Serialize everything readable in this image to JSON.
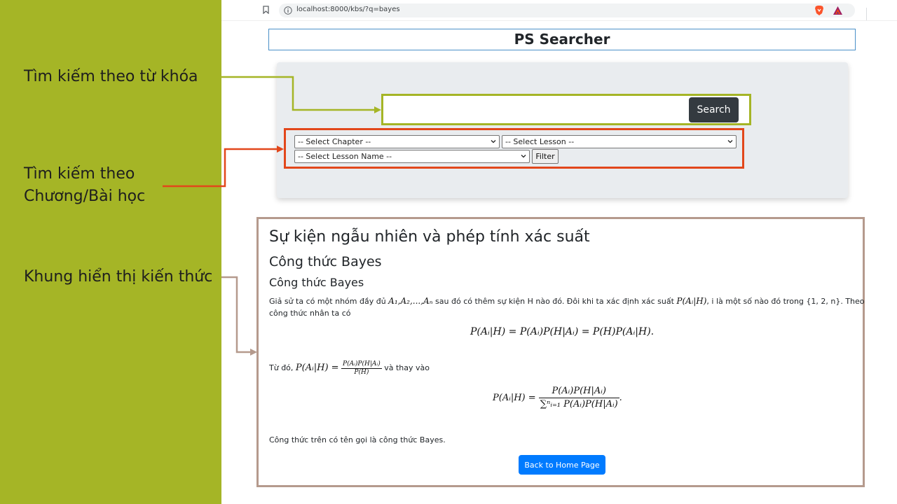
{
  "annotations": {
    "keyword_search": "Tìm kiếm theo từ khóa",
    "chapter_search_line1": "Tìm kiếm theo",
    "chapter_search_line2": "Chương/Bài học",
    "knowledge_frame": "Khung hiển thị kiến thức"
  },
  "browser": {
    "url": "localhost:8000/kbs/?q=bayes"
  },
  "app": {
    "title": "PS Searcher"
  },
  "search": {
    "value": "",
    "button_label": "Search"
  },
  "filters": {
    "chapter_placeholder": "-- Select Chapter --",
    "lesson_placeholder": "-- Select Lesson --",
    "lesson_name_placeholder": "-- Select Lesson Name --",
    "filter_label": "Filter"
  },
  "content": {
    "chapter_title": "Sự kiện ngẫu nhiên và phép tính xác suất",
    "lesson_title": "Công thức Bayes",
    "section_title": "Công thức Bayes",
    "para1_a": "Giả sử ta có một nhóm đầy đủ ",
    "para1_math_a": "A₁,A₂,...,Aₙ",
    "para1_b": " sau đó có thêm sự kiện H nào đó. Đôi khi ta xác định xác suất ",
    "para1_math_b": "P(Aᵢ|H)",
    "para1_c": ", i là một số nào đó trong {1, 2, n}. Theo",
    "para1_line2": "công thức nhân ta có",
    "eq1": "P(Aᵢ|H) = P(Aᵢ)P(H|Aᵢ) = P(H)P(Aᵢ|H).",
    "para2_a": "Từ đó, ",
    "para2_lhs": "P(Aᵢ|H) =",
    "para2_num": "P(Aᵢ)P(H|Aᵢ)",
    "para2_den": "P(H)",
    "para2_b": " và thay vào",
    "eq2_lhs": "P(Aᵢ|H) =",
    "eq2_num": "P(Aᵢ)P(H|Aᵢ)",
    "eq2_den": "∑ⁿᵢ₌₁ P(Aᵢ)P(H|Aᵢ)",
    "eq2_end": ".",
    "para3": "Công thức trên có tên gọi là công thức Bayes.",
    "back_button": "Back to Home Page"
  },
  "colors": {
    "left_panel": "#a5b526",
    "keyword_frame": "#a5b526",
    "filter_frame": "#e2471b",
    "content_frame": "#b59a8d",
    "primary_button": "#007bff",
    "dark_button": "#343a40"
  }
}
